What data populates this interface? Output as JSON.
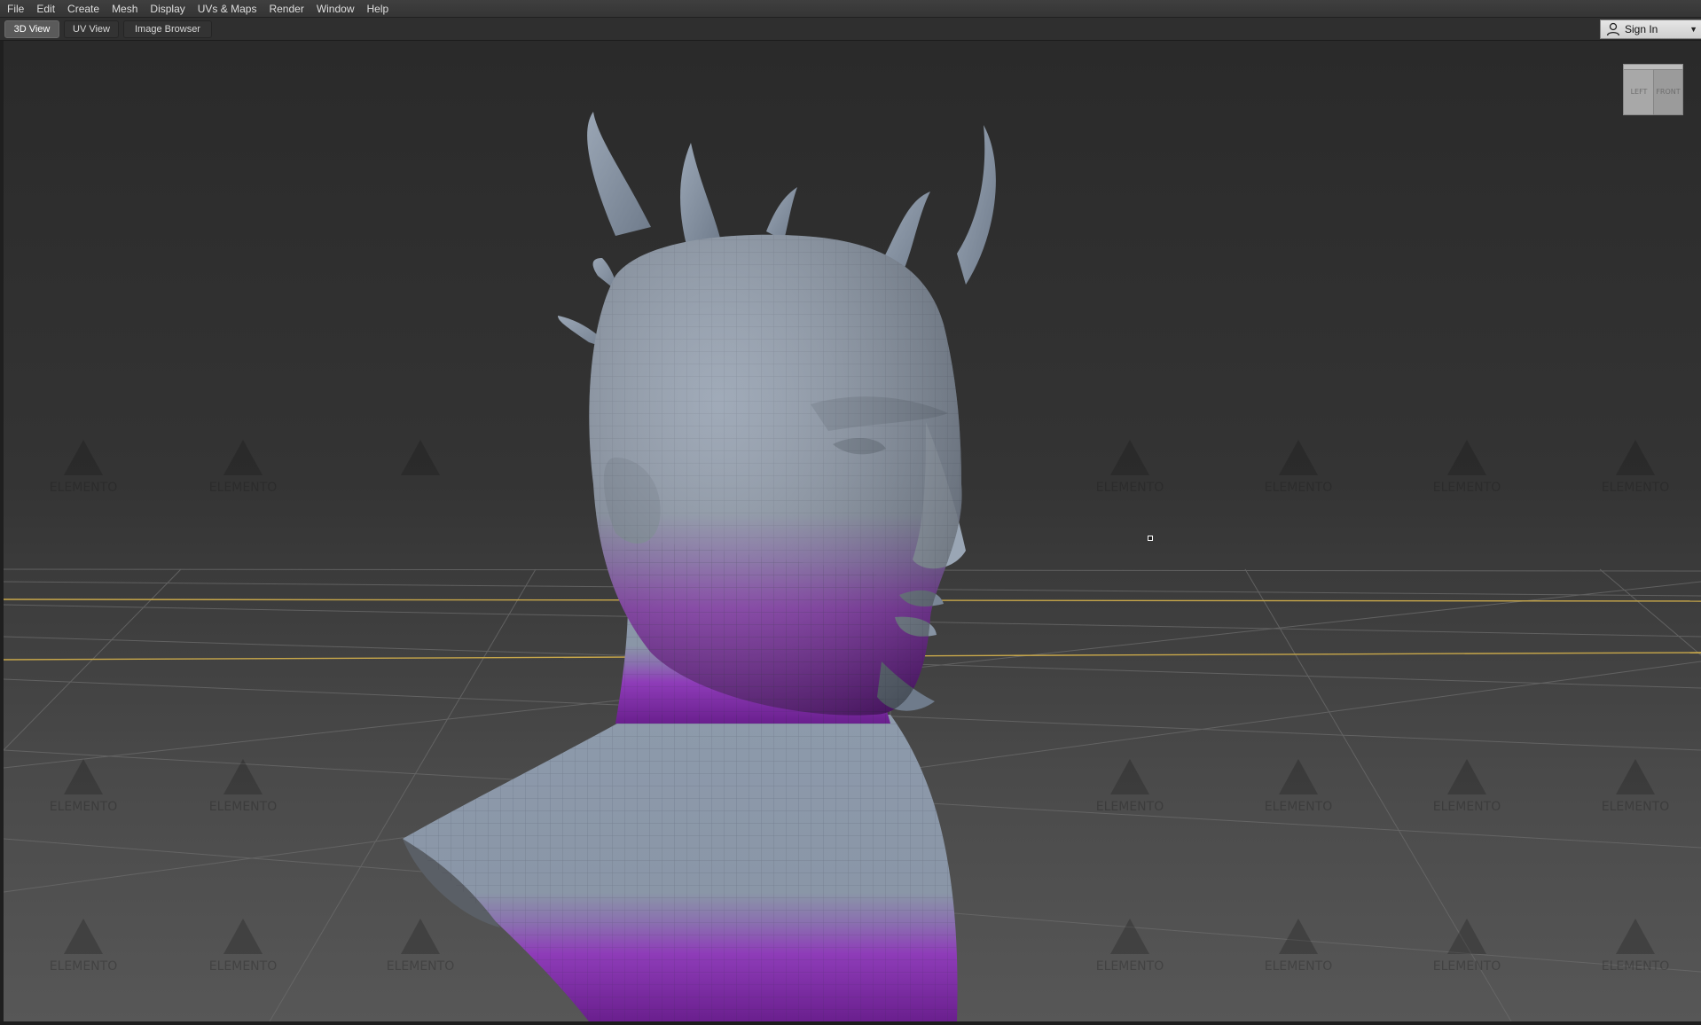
{
  "menu": {
    "items": [
      "File",
      "Edit",
      "Create",
      "Mesh",
      "Display",
      "UVs & Maps",
      "Render",
      "Window",
      "Help"
    ]
  },
  "tabs": {
    "items": [
      "3D View",
      "UV View",
      "Image Browser"
    ],
    "active": "3D View"
  },
  "account": {
    "signin_label": "Sign In",
    "icon": "user-icon"
  },
  "viewcube": {
    "left_label": "LEFT",
    "front_label": "FRONT"
  },
  "watermark": {
    "text": "ELEMENTO"
  },
  "colors": {
    "accent_tab": "#5a5a5a",
    "mesh_grey": "#8a97a8",
    "mesh_purple": "#8b2fb0",
    "grid_axis": "#c9a84a"
  }
}
